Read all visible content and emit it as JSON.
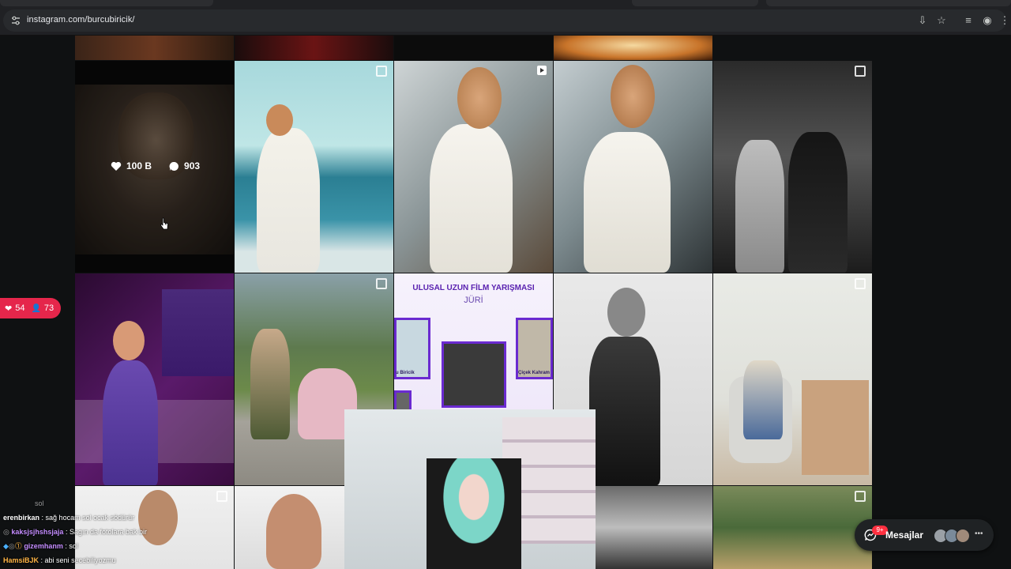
{
  "browser": {
    "url": "instagram.com/burcubiricik/"
  },
  "post_overlay": {
    "likes": "100 B",
    "comments": "903"
  },
  "posters": {
    "contest_title": "ULUSAL UZUN FİLM YARIŞMASI",
    "contest_sub": "JÜRİ",
    "jury_left": "u Biricik",
    "jury_right": "Çiçek Kahram"
  },
  "live": {
    "hearts": "54",
    "viewers": "73"
  },
  "chat": [
    {
      "user": "",
      "message": "sol"
    },
    {
      "user": "erenbirkan",
      "message": ": sağ hocam sol ocak södürür",
      "color": "#ffffff"
    },
    {
      "user": "kaksjsjhshsjaja",
      "message": ": Sagın da fotolara bak bir",
      "color": "#c48cff"
    },
    {
      "user": "gizemhanm",
      "message": ": sol",
      "color": "#c48cff"
    },
    {
      "user": "HamsiBJK",
      "message": ": abi seni secebiliyozmu",
      "color": "#ffb545"
    }
  ],
  "messages": {
    "label": "Mesajlar",
    "badge": "9+"
  },
  "colors": {
    "accent_live": "#e5264b",
    "messages_bg": "#1f2224"
  }
}
